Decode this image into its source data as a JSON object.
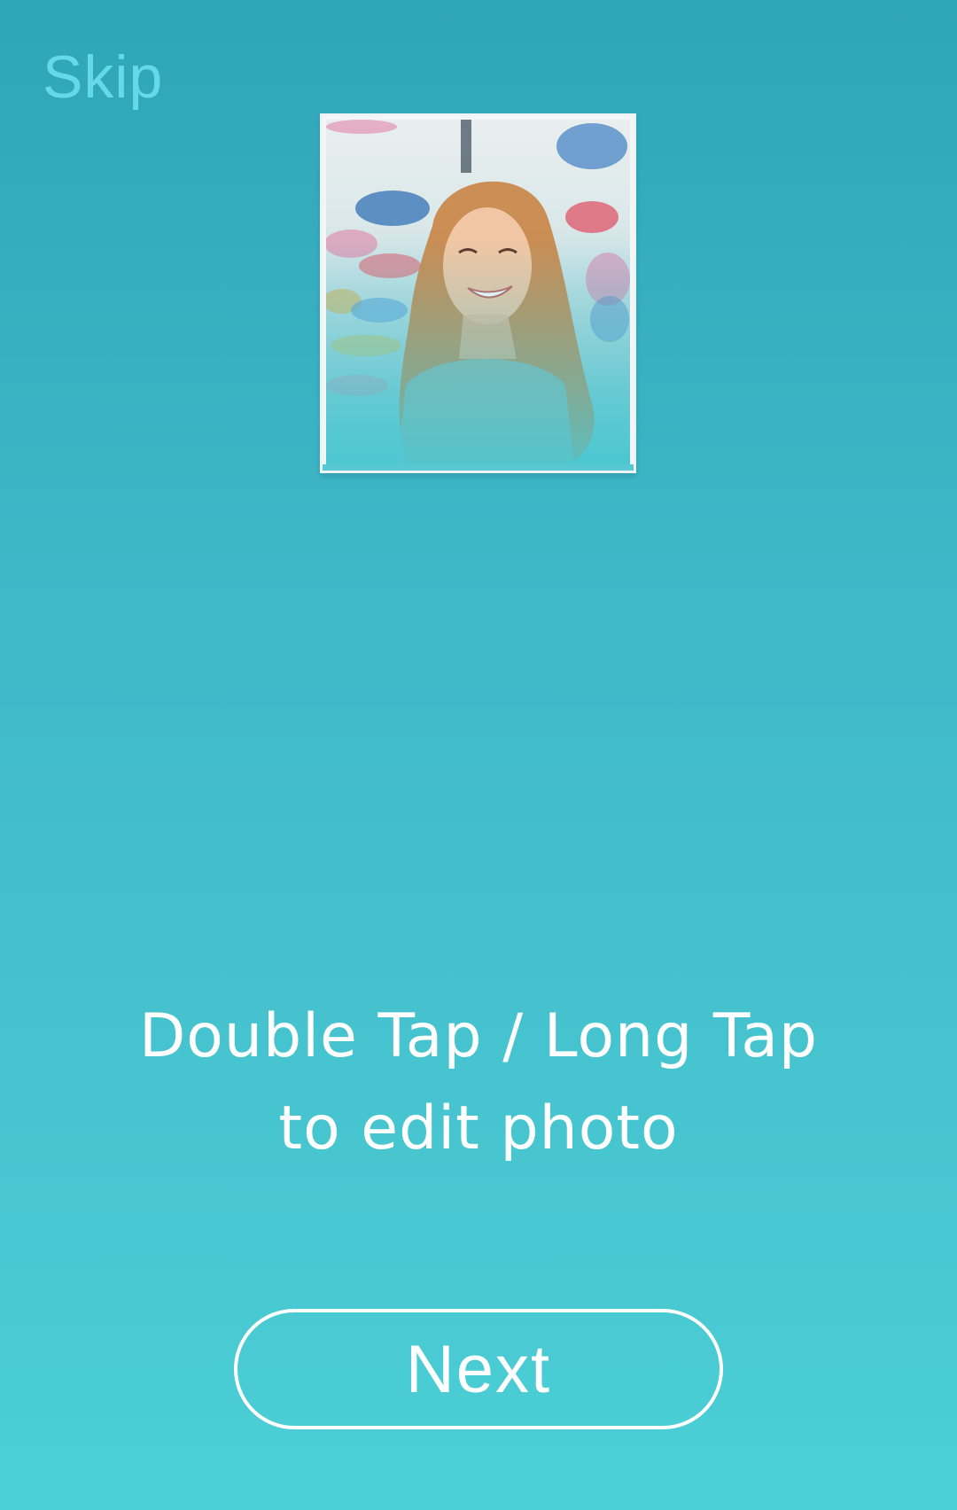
{
  "header": {
    "skip_label": "Skip"
  },
  "tutorial": {
    "line1": "Double Tap / Long Tap",
    "line2": "to edit photo"
  },
  "footer": {
    "next_label": "Next"
  },
  "colors": {
    "background_top": "#2fa6b8",
    "background_bottom": "#4ccfd6",
    "skip_text": "#66d9e8",
    "foreground": "#ffffff"
  }
}
